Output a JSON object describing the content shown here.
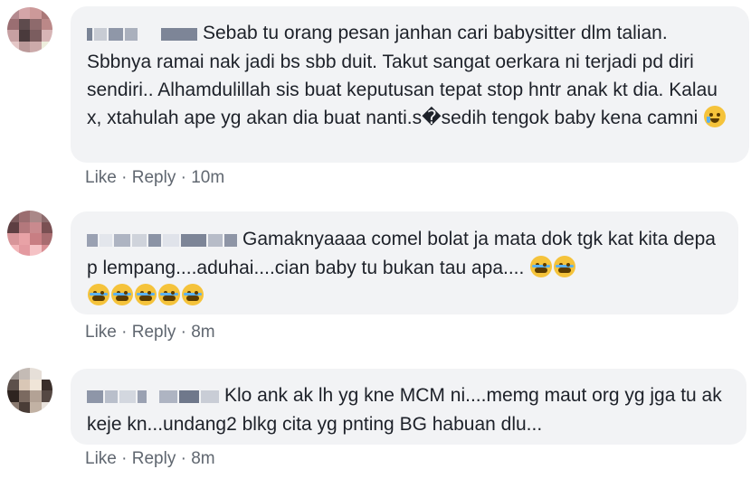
{
  "comments": [
    {
      "text": "Sebab tu orang pesan janhan cari babysitter dlm talian. Sbbnya ramai nak jadi bs sbb duit. Takut sangat oerkara ni terjadi pd diri sendiri.. Alhamdulillah sis buat keputusan tepat stop hntr anak kt dia. Kalau x, xtahulah ape yg akan dia buat nanti.s�sedih tengok baby kena camni",
      "emojis": [
        "crying-face"
      ],
      "like": "Like",
      "reply": "Reply",
      "time": "10m"
    },
    {
      "text": "Gamaknyaaaa comel bolat ja mata dok tgk kat kita depa p lempang....aduhai....cian baby tu bukan tau apa....",
      "emojis": [
        "loudly-crying-face",
        "loudly-crying-face",
        "loudly-crying-face",
        "loudly-crying-face",
        "loudly-crying-face",
        "loudly-crying-face",
        "loudly-crying-face"
      ],
      "like": "Like",
      "reply": "Reply",
      "time": "8m"
    },
    {
      "text": "Klo ank ak lh yg kne MCM ni....memg maut org yg jga tu ak keje kn...undang2 blkg cita yg pnting BG habuan dlu...",
      "emojis": [],
      "like": "Like",
      "reply": "Reply",
      "time": "8m"
    }
  ],
  "separator": "·",
  "colors": {
    "bubble": "#f2f3f5",
    "text": "#1d2129",
    "meta": "#606770"
  }
}
